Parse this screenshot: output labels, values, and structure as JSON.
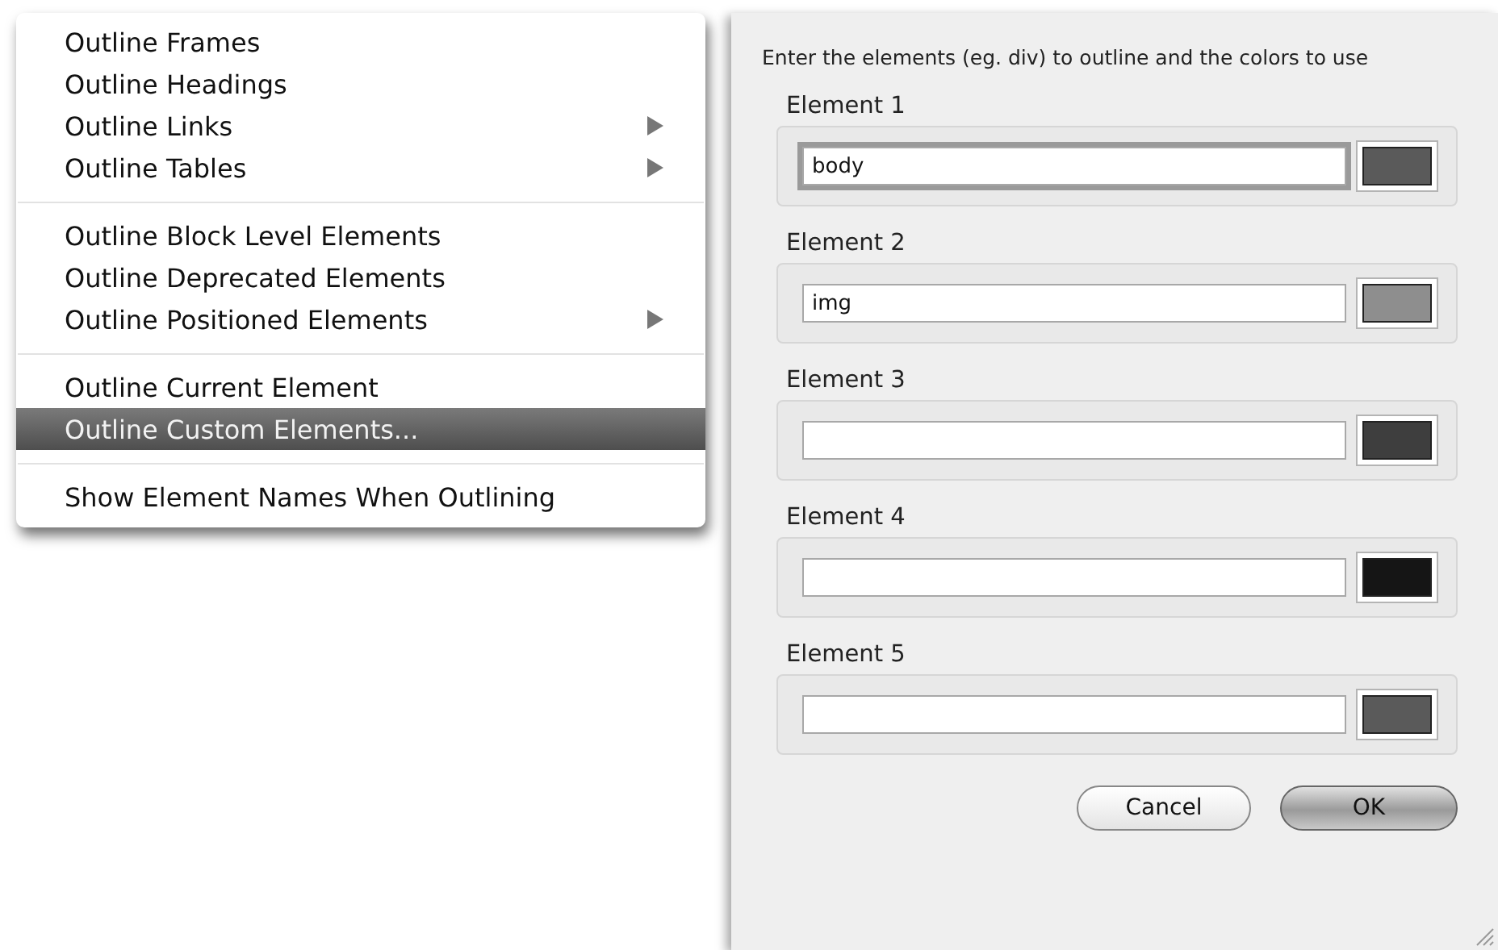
{
  "menu": {
    "sections": [
      {
        "items": [
          {
            "label": "Outline Frames",
            "has_submenu": false,
            "selected": false
          },
          {
            "label": "Outline Headings",
            "has_submenu": false,
            "selected": false
          },
          {
            "label": "Outline Links",
            "has_submenu": true,
            "selected": false
          },
          {
            "label": "Outline Tables",
            "has_submenu": true,
            "selected": false
          }
        ]
      },
      {
        "items": [
          {
            "label": "Outline Block Level Elements",
            "has_submenu": false,
            "selected": false
          },
          {
            "label": "Outline Deprecated Elements",
            "has_submenu": false,
            "selected": false
          },
          {
            "label": "Outline Positioned Elements",
            "has_submenu": true,
            "selected": false
          }
        ]
      },
      {
        "items": [
          {
            "label": "Outline Current Element",
            "has_submenu": false,
            "selected": false
          },
          {
            "label": "Outline Custom Elements...",
            "has_submenu": false,
            "selected": true
          }
        ]
      },
      {
        "items": [
          {
            "label": "Show Element Names When Outlining",
            "has_submenu": false,
            "selected": false
          }
        ]
      }
    ]
  },
  "dialog": {
    "instruction": "Enter the elements (eg. div) to outline and the colors to use",
    "elements": [
      {
        "label": "Element 1",
        "value": "body",
        "focused": true,
        "color": "#5a5a5a"
      },
      {
        "label": "Element 2",
        "value": "img",
        "focused": false,
        "color": "#8e8e8e"
      },
      {
        "label": "Element 3",
        "focused": false,
        "color": "#3e3e3e"
      },
      {
        "label": "Element 4",
        "focused": false,
        "color": "#151515"
      },
      {
        "label": "Element 5",
        "focused": false,
        "color": "#5a5a5a"
      }
    ],
    "buttons": [
      {
        "label": "Cancel",
        "default": false
      },
      {
        "label": "OK",
        "default": true
      }
    ]
  }
}
